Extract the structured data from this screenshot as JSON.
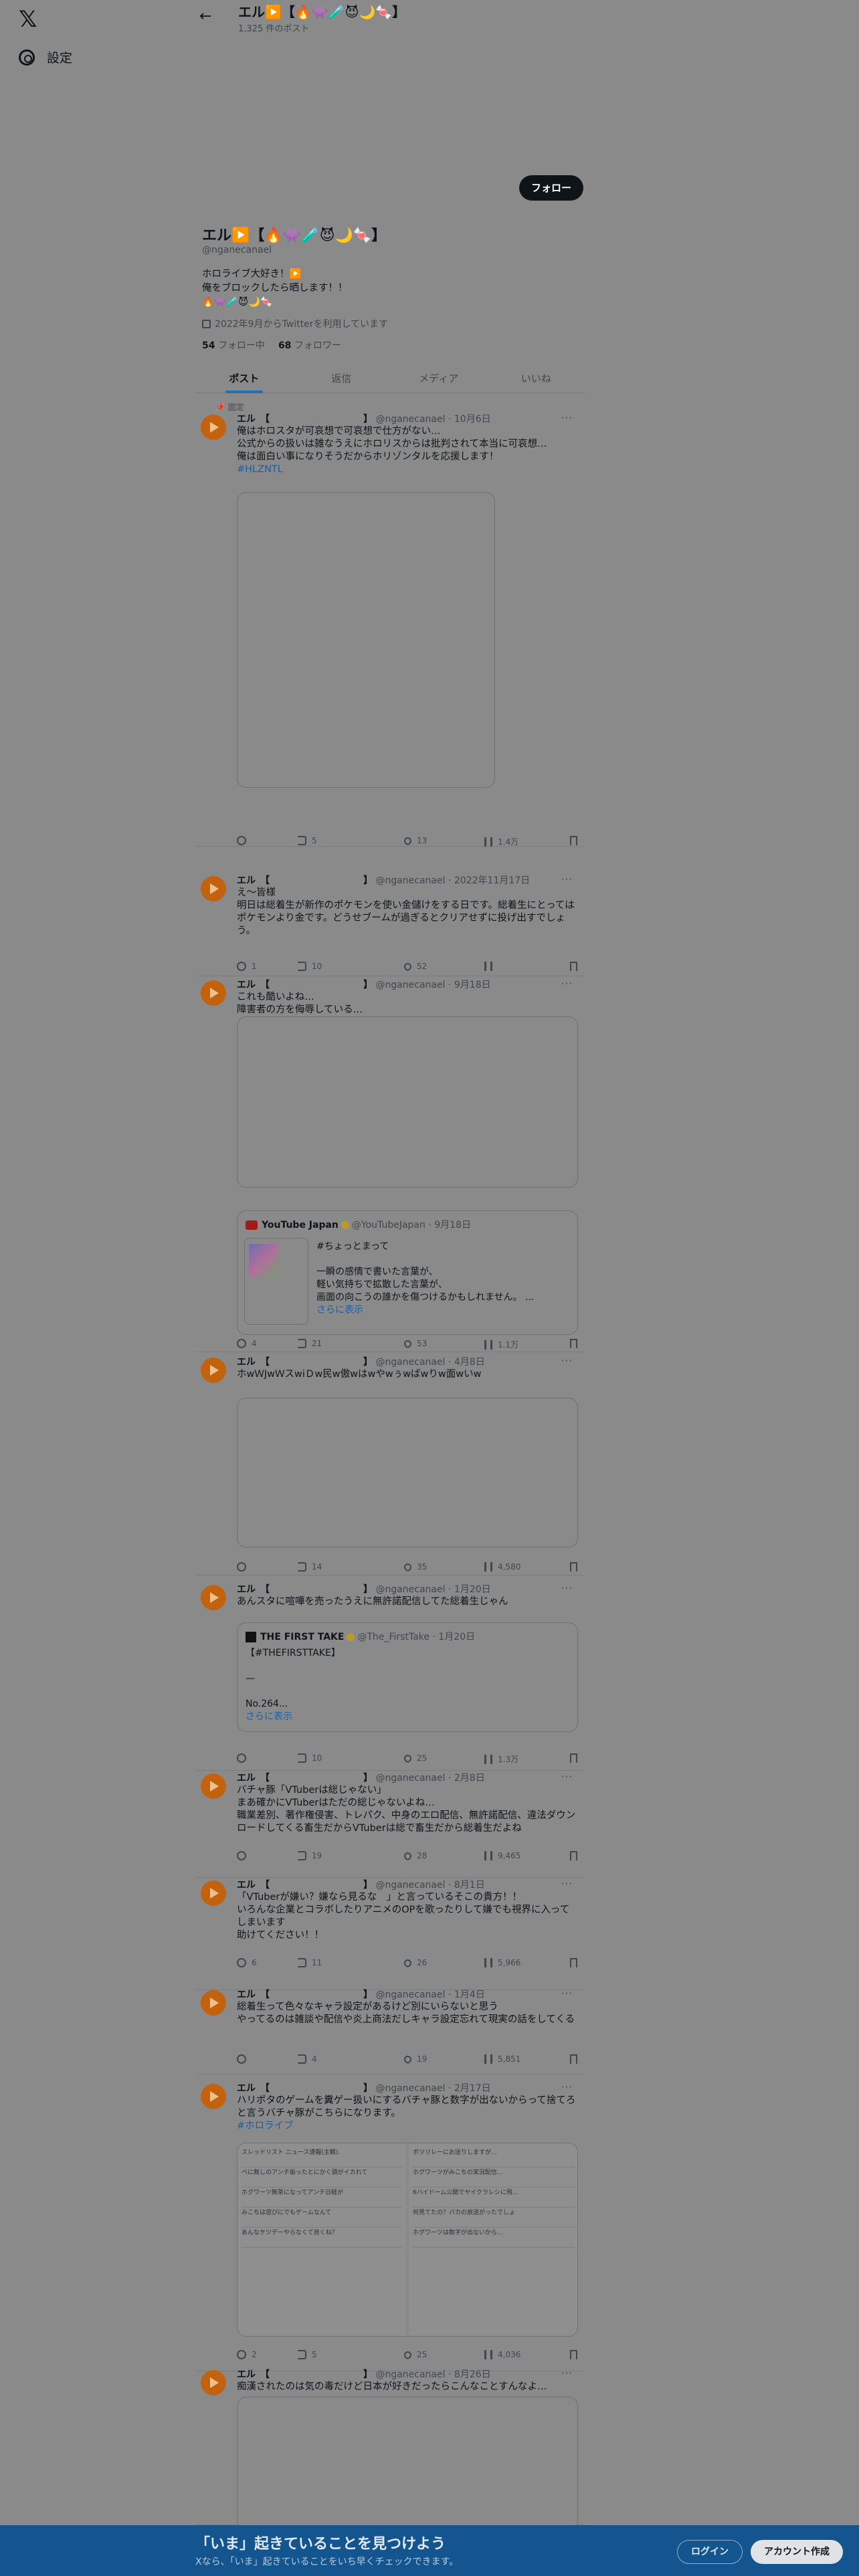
{
  "nav": {
    "settings_label": "設定"
  },
  "topbar": {
    "name": "エル▶️【🔥👾🧪😈🌙🍬】",
    "post_count": "1,325 件のポスト"
  },
  "profile": {
    "follow_label": "フォロー",
    "name": "エル▶️【🔥👾🧪😈🌙🍬】",
    "handle": "@nganecanael",
    "bio_lines": [
      "ホロライブ大好き！▶️",
      "俺をブロックしたら晒します！！",
      "🔥👾🧪😈🌙🍬"
    ],
    "joined": "2022年9月からTwitterを利用しています",
    "following_count": "54",
    "following_label": "フォロー中",
    "followers_count": "68",
    "followers_label": "フォロワー"
  },
  "tabs": [
    "ポスト",
    "返信",
    "メディア",
    "いいね"
  ],
  "pinned_label": "📌 固定",
  "tweets": [
    {
      "name": "エル　【　　　　　　　　　　】",
      "handle": "@nganecanael",
      "date": "10月6日",
      "lines": [
        "俺はホロスタが可哀想で可哀想で仕方がない…",
        "公式からの扱いは雑なうえにホロリスからは批判されて本当に可哀想…",
        "俺は面白い事になりそうだからホリゾンタルを応援します！"
      ],
      "tag": "#HLZNTL",
      "replies": "",
      "retweets": "5",
      "likes": "13",
      "views": "1.4万"
    },
    {
      "name": "エル　【　　　　　　　　　　】",
      "handle": "@nganecanael",
      "date": "2022年11月17日",
      "lines": [
        "え～皆様",
        "明日は総着生が新作のポケモンを使い金儲けをする日です。総着生にとってはポケモンより金です。どうせブームが過ぎるとクリアせずに投げ出すでしょう。"
      ],
      "replies": "1",
      "retweets": "10",
      "likes": "52",
      "views": ""
    },
    {
      "name": "エル　【　　　　　　　　　　】",
      "handle": "@nganecanael",
      "date": "9月18日",
      "lines": [
        "これも酷いよね…",
        "障害者の方を侮辱している…"
      ],
      "quote": {
        "name": "YouTube Japan",
        "handle": "@YouTubeJapan",
        "date": "9月18日",
        "lines": [
          "#ちょっとまって",
          "",
          "一瞬の感情で書いた言葉が、",
          "軽い気持ちで拡散した言葉が、",
          "画面の向こうの誰かを傷つけるかもしれません。 ..."
        ],
        "show_more": "さらに表示"
      },
      "replies": "4",
      "retweets": "21",
      "likes": "53",
      "views": "1.1万"
    },
    {
      "name": "エル　【　　　　　　　　　　】",
      "handle": "@nganecanael",
      "date": "4月8日",
      "lines": [
        "ホwＷJwＷスwiＤw民w傲wはwやwぅwばwりw面wいw"
      ],
      "replies": "",
      "retweets": "14",
      "likes": "35",
      "views": "4,580"
    },
    {
      "name": "エル　【　　　　　　　　　　】",
      "handle": "@nganecanael",
      "date": "1月20日",
      "lines": [
        "あんスタに喧嘩を売ったうえに無許諾配信してた総着生じゃん"
      ],
      "quote": {
        "name": "THE FIRST TAKE",
        "handle": "@The_FirstTake",
        "date": "1月20日",
        "lines": [
          "【#THEFIRSTTAKE】",
          "",
          "—",
          "",
          "No.264..."
        ],
        "show_more": "さらに表示"
      },
      "replies": "",
      "retweets": "10",
      "likes": "25",
      "views": "1.3万"
    },
    {
      "name": "エル　【　　　　　　　　　　】",
      "handle": "@nganecanael",
      "date": "2月8日",
      "lines": [
        "バチャ豚「VTuberは総じゃない」",
        "まあ確かにVTuberはただの総じゃないよね…",
        "職業差別、著作権侵害、トレパク、中身のエロ配信、無許諾配信、違法ダウンロードしてくる畜生だからVTuberは総で畜生だから総着生だよね"
      ],
      "replies": "",
      "retweets": "19",
      "likes": "28",
      "views": "9,465"
    },
    {
      "name": "エル　【　　　　　　　　　　】",
      "handle": "@nganecanael",
      "date": "8月1日",
      "lines": [
        "「VTuberが嫌い？嫌なら見るな　」と言っているそこの貴方！！",
        "いろんな企業とコラボしたりアニメのOPを歌ったりして嫌でも視界に入ってしまいます",
        "助けてください！！"
      ],
      "replies": "6",
      "retweets": "11",
      "likes": "26",
      "views": "5,966"
    },
    {
      "name": "エル　【　　　　　　　　　　】",
      "handle": "@nganecanael",
      "date": "1月4日",
      "lines": [
        "総着生って色々なキャラ設定があるけど別にいらないと思う",
        "やってるのは雑談や配信や炎上商法だしキャラ設定忘れて現実の話をしてくる"
      ],
      "replies": "",
      "retweets": "4",
      "likes": "19",
      "views": "5,851"
    },
    {
      "name": "エル　【　　　　　　　　　　】",
      "handle": "@nganecanael",
      "date": "2月17日",
      "lines": [
        "ハリポタのゲームを糞ゲー扱いにするバチャ豚と数字が出ないからって捨てろと言うバチャ豚がこちらになります。"
      ],
      "tag": "#ホロライブ",
      "shots": {
        "left": [
          "スレッドリスト ニュース速報(主観).",
          "ベに無しのアンチ垢ったとにかく頭がイカれて",
          "ホグワーツ無茶になってアンチ日経が",
          "みこちは遊びにでもゲームなんて",
          "あんなケツデーやらなくて良くね？"
        ],
        "right": [
          "ボツリレーにお送りしますが…",
          "ホグワーツがみこちの実況配信…",
          "6ハイドーム公開でヤイクラレシに飛…",
          "何見てたの？バカの放送がったでしょ",
          "ホグワーツは数字が出ないから…"
        ]
      },
      "replies": "2",
      "retweets": "5",
      "likes": "25",
      "views": "4,036"
    },
    {
      "name": "エル　【　　　　　　　　　　】",
      "handle": "@nganecanael",
      "date": "8月26日",
      "lines": [
        "痴漢されたのは気の毒だけど日本が好きだったらこんなことすんなよ…"
      ],
      "replies": "",
      "retweets": "",
      "likes": "",
      "views": ""
    }
  ],
  "banner": {
    "title": "「いま」起きていることを見つけよう",
    "subtitle": "Xなら、「いま」起きていることをいち早くチェックできます。",
    "login_label": "ログイン",
    "signup_label": "アカウント作成"
  }
}
